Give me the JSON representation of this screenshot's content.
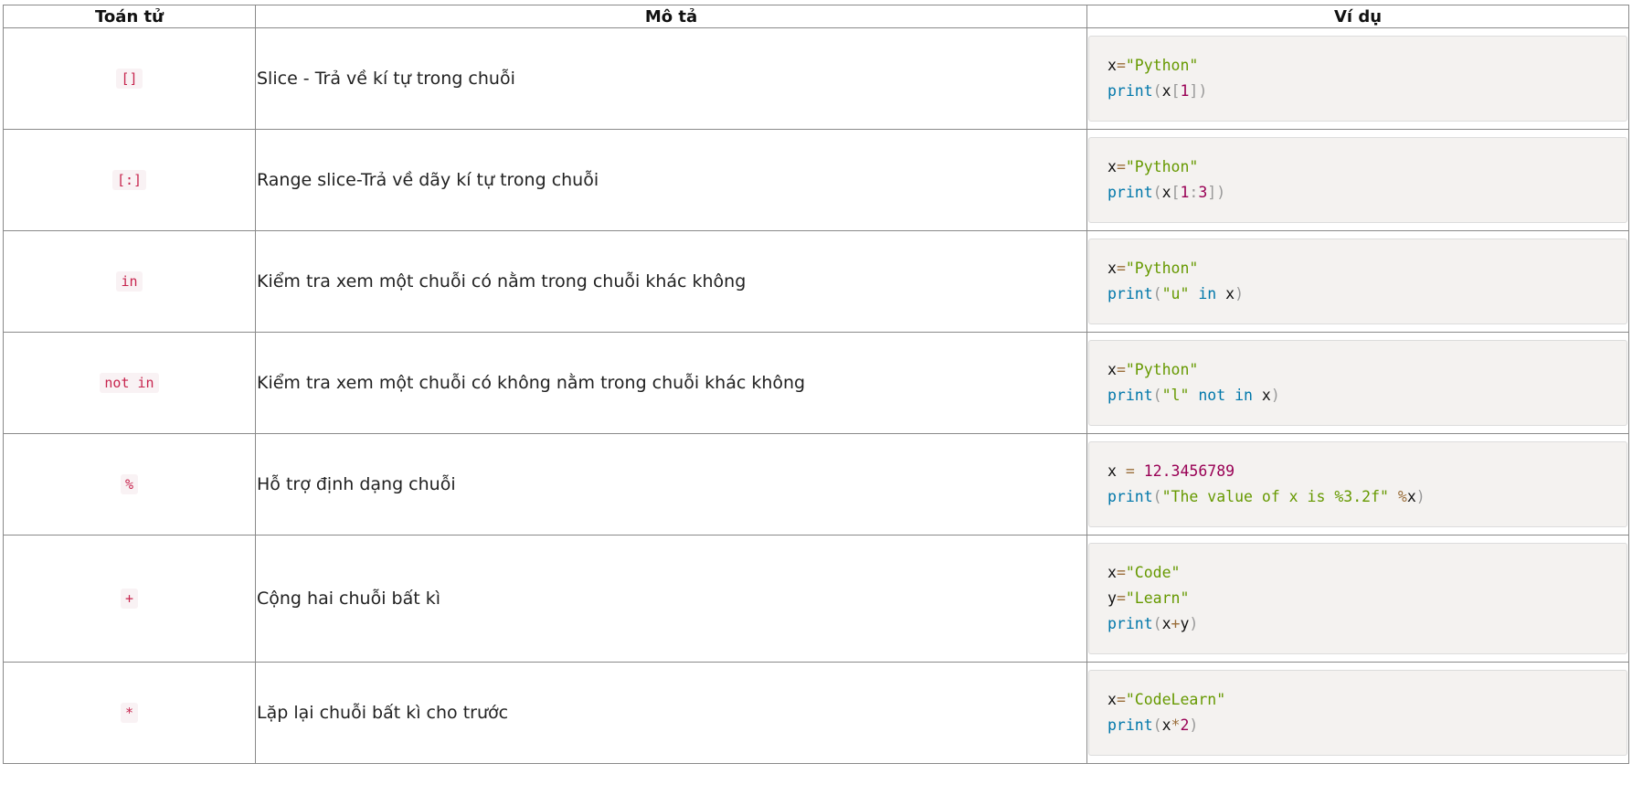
{
  "table": {
    "headers": [
      "Toán tử",
      "Mô tả",
      "Ví dụ"
    ],
    "rows": [
      {
        "operator": "[]",
        "description": "Slice - Trả về kí tự trong chuỗi",
        "code_lines": [
          [
            {
              "t": "v",
              "s": "x"
            },
            {
              "t": "o",
              "s": "="
            },
            {
              "t": "s",
              "s": "\"Python\""
            }
          ],
          [
            {
              "t": "f",
              "s": "print"
            },
            {
              "t": "p",
              "s": "("
            },
            {
              "t": "v",
              "s": "x"
            },
            {
              "t": "p",
              "s": "["
            },
            {
              "t": "n",
              "s": "1"
            },
            {
              "t": "p",
              "s": "])"
            }
          ]
        ]
      },
      {
        "operator": "[:]",
        "description": "Range slice-Trả về dãy kí tự trong chuỗi",
        "code_lines": [
          [
            {
              "t": "v",
              "s": "x"
            },
            {
              "t": "o",
              "s": "="
            },
            {
              "t": "s",
              "s": "\"Python\""
            }
          ],
          [
            {
              "t": "f",
              "s": "print"
            },
            {
              "t": "p",
              "s": "("
            },
            {
              "t": "v",
              "s": "x"
            },
            {
              "t": "p",
              "s": "["
            },
            {
              "t": "n",
              "s": "1"
            },
            {
              "t": "p",
              "s": ":"
            },
            {
              "t": "n",
              "s": "3"
            },
            {
              "t": "p",
              "s": "])"
            }
          ]
        ]
      },
      {
        "operator": "in",
        "description": "Kiểm tra xem một chuỗi có nằm trong chuỗi khác không",
        "code_lines": [
          [
            {
              "t": "v",
              "s": "x"
            },
            {
              "t": "o",
              "s": "="
            },
            {
              "t": "s",
              "s": "\"Python\""
            }
          ],
          [
            {
              "t": "f",
              "s": "print"
            },
            {
              "t": "p",
              "s": "("
            },
            {
              "t": "s",
              "s": "\"u\""
            },
            {
              "t": "v",
              "s": " "
            },
            {
              "t": "f",
              "s": "in"
            },
            {
              "t": "v",
              "s": " x"
            },
            {
              "t": "p",
              "s": ")"
            }
          ]
        ]
      },
      {
        "operator": "not in",
        "description": "Kiểm tra xem một chuỗi có không nằm trong chuỗi khác không",
        "code_lines": [
          [
            {
              "t": "v",
              "s": "x"
            },
            {
              "t": "o",
              "s": "="
            },
            {
              "t": "s",
              "s": "\"Python\""
            }
          ],
          [
            {
              "t": "f",
              "s": "print"
            },
            {
              "t": "p",
              "s": "("
            },
            {
              "t": "s",
              "s": "\"l\""
            },
            {
              "t": "v",
              "s": " "
            },
            {
              "t": "f",
              "s": "not"
            },
            {
              "t": "v",
              "s": " "
            },
            {
              "t": "f",
              "s": "in"
            },
            {
              "t": "v",
              "s": " x"
            },
            {
              "t": "p",
              "s": ")"
            }
          ]
        ]
      },
      {
        "operator": "%",
        "description": "Hỗ trợ định dạng chuỗi",
        "code_lines": [
          [
            {
              "t": "v",
              "s": "x "
            },
            {
              "t": "o",
              "s": "="
            },
            {
              "t": "v",
              "s": " "
            },
            {
              "t": "n",
              "s": "12.3456789"
            }
          ],
          [
            {
              "t": "f",
              "s": "print"
            },
            {
              "t": "p",
              "s": "("
            },
            {
              "t": "s",
              "s": "\"The value of x is %3.2f\""
            },
            {
              "t": "v",
              "s": " "
            },
            {
              "t": "o",
              "s": "%"
            },
            {
              "t": "v",
              "s": "x"
            },
            {
              "t": "p",
              "s": ")"
            }
          ]
        ]
      },
      {
        "operator": "+",
        "description": "Cộng hai chuỗi bất kì",
        "code_lines": [
          [
            {
              "t": "v",
              "s": "x"
            },
            {
              "t": "o",
              "s": "="
            },
            {
              "t": "s",
              "s": "\"Code\""
            }
          ],
          [
            {
              "t": "v",
              "s": "y"
            },
            {
              "t": "o",
              "s": "="
            },
            {
              "t": "s",
              "s": "\"Learn\""
            }
          ],
          [
            {
              "t": "f",
              "s": "print"
            },
            {
              "t": "p",
              "s": "("
            },
            {
              "t": "v",
              "s": "x"
            },
            {
              "t": "o",
              "s": "+"
            },
            {
              "t": "v",
              "s": "y"
            },
            {
              "t": "p",
              "s": ")"
            }
          ]
        ]
      },
      {
        "operator": "*",
        "description": "Lặp lại chuỗi bất kì cho trước",
        "code_lines": [
          [
            {
              "t": "v",
              "s": "x"
            },
            {
              "t": "o",
              "s": "="
            },
            {
              "t": "s",
              "s": "\"CodeLearn\""
            }
          ],
          [
            {
              "t": "f",
              "s": "print"
            },
            {
              "t": "p",
              "s": "("
            },
            {
              "t": "v",
              "s": "x"
            },
            {
              "t": "o",
              "s": "*"
            },
            {
              "t": "n",
              "s": "2"
            },
            {
              "t": "p",
              "s": ")"
            }
          ]
        ]
      }
    ]
  }
}
